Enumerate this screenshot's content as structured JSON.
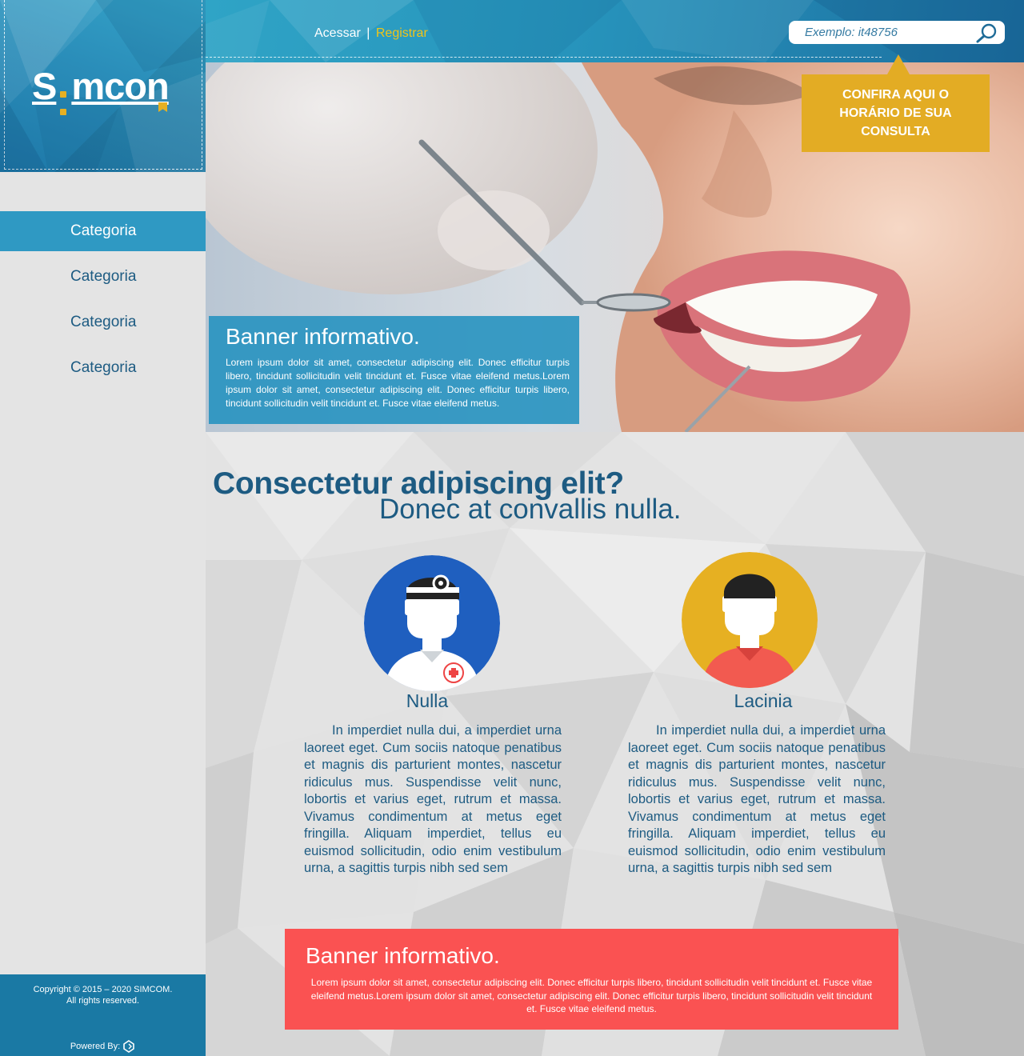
{
  "brand": {
    "logo_left": "S",
    "logo_right": "mcon",
    "accent_color": "#e6b022",
    "primary_color": "#2f99c3"
  },
  "header": {
    "login_label": "Acessar",
    "separator": "|",
    "register_label": "Registrar",
    "search_placeholder": "Exemplo: it48756",
    "search_icon": "search-icon"
  },
  "sidebar": {
    "items": [
      {
        "label": "Categoria",
        "active": true
      },
      {
        "label": "Categoria",
        "active": false
      },
      {
        "label": "Categoria",
        "active": false
      },
      {
        "label": "Categoria",
        "active": false
      }
    ]
  },
  "hero": {
    "title": "Banner informativo.",
    "text": "Lorem ipsum dolor sit amet, consectetur adipiscing elit. Donec efficitur turpis libero, tincidunt sollicitudin velit tincidunt et. Fusce vitae eleifend metus.Lorem ipsum dolor sit amet, consectetur adipiscing elit. Donec efficitur turpis libero, tincidunt sollicitudin velit tincidunt et. Fusce vitae eleifend metus.",
    "cta_label": "CONFIRA AQUI O HORÁRIO DE SUA CONSULTA"
  },
  "main": {
    "headline": "Consectetur adipiscing elit?",
    "subheadline": "Donec at convallis nulla.",
    "cards": [
      {
        "name": "Nulla",
        "avatar": "doctor-avatar-icon",
        "avatar_color": "#1f5fbf",
        "text": "In imperdiet nulla dui, a imperdiet urna laoreet eget. Cum sociis natoque penatibus et magnis dis parturient montes, nascetur ridiculus mus. Suspendisse velit nunc, lobortis et varius eget, rutrum et massa. Vivamus condimentum at metus eget fringilla. Aliquam imperdiet, tellus eu euismod sollicitudin, odio enim vestibulum urna, a sagittis turpis nibh sed sem"
      },
      {
        "name": "Lacinia",
        "avatar": "patient-avatar-icon",
        "avatar_color": "#e6b022",
        "text": "In imperdiet nulla dui, a imperdiet urna laoreet eget. Cum sociis natoque penatibus et magnis dis parturient montes, nascetur ridiculus mus. Suspendisse velit nunc, lobortis et varius eget, rutrum et massa. Vivamus condimentum at metus eget fringilla. Aliquam imperdiet, tellus eu euismod sollicitudin, odio enim vestibulum urna, a sagittis turpis nibh sed sem"
      }
    ],
    "banner": {
      "title": "Banner informativo.",
      "text": "Lorem ipsum dolor sit amet, consectetur adipiscing elit. Donec efficitur turpis libero, tincidunt sollicitudin velit tincidunt et. Fusce vitae eleifend metus.Lorem ipsum dolor sit amet, consectetur adipiscing elit. Donec efficitur turpis libero, tincidunt sollicitudin velit tincidunt et. Fusce vitae eleifend metus.",
      "color": "#fa5252"
    }
  },
  "footer": {
    "copyright_line1": "Copyright © 2015 – 2020 SIMCOM.",
    "copyright_line2": "All rights reserved.",
    "powered_by": "Powered By:",
    "powered_icon": "powered-by-logo-icon"
  }
}
